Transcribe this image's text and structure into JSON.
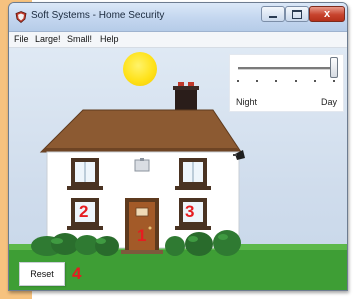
{
  "window": {
    "title": "Soft Systems - Home Security",
    "close_glyph": "x"
  },
  "menu": {
    "items": [
      "File",
      "Large!",
      "Small!",
      "Help"
    ]
  },
  "daylight_slider": {
    "min_label": "Night",
    "max_label": "Day",
    "value_fraction": 1.0,
    "tick_count": 6
  },
  "rooms": [
    {
      "label": "1",
      "location": "front door"
    },
    {
      "label": "2",
      "location": "downstairs left window"
    },
    {
      "label": "3",
      "location": "downstairs right window"
    }
  ],
  "reset": {
    "label": "Reset",
    "callout": "4"
  },
  "colors": {
    "callout_red": "#e61c20",
    "roof_brown": "#8c5a32",
    "wall_white": "#ffffff",
    "door_brown": "#a35a28",
    "bush_green": "#2f7a32",
    "grass_green": "#3e9e35",
    "sun_yellow": "#ffe21a",
    "chimney_dark": "#2a1d1a",
    "chimney_pot_red": "#c0392b"
  },
  "icons": {
    "app": "shield-icon",
    "minimize": "minimize-icon",
    "maximize": "maximize-icon",
    "close": "close-icon",
    "alarm_bell": "alarm-bell-icon",
    "lamp": "wall-lamp-icon"
  }
}
